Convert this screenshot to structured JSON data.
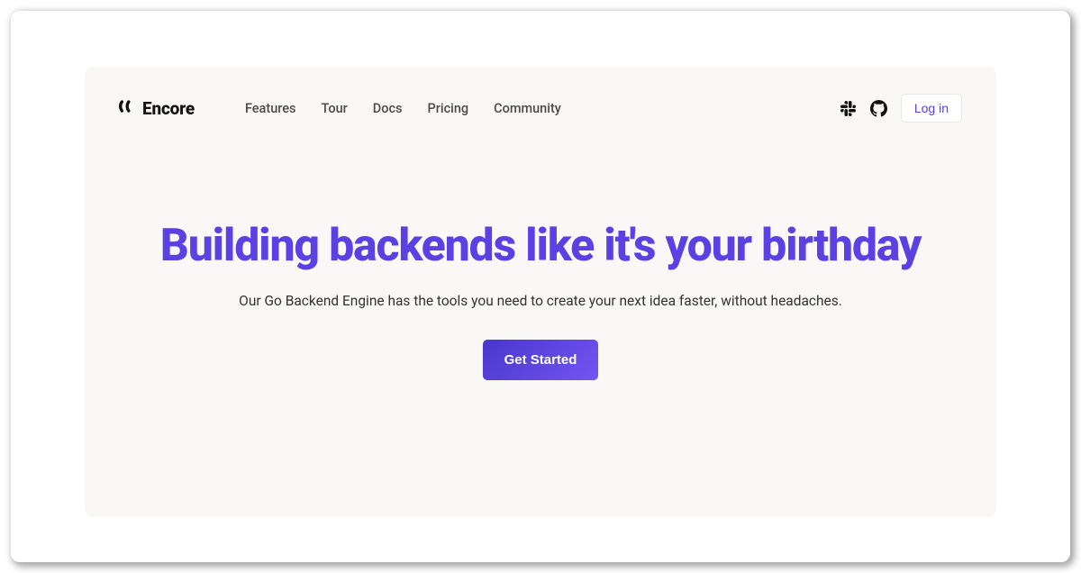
{
  "brand": {
    "name": "Encore"
  },
  "nav": {
    "items": [
      "Features",
      "Tour",
      "Docs",
      "Pricing",
      "Community"
    ],
    "login": "Log in"
  },
  "hero": {
    "title": "Building backends like it's your birthday",
    "subtitle": "Our Go Backend Engine has the tools you need to create your next idea faster, without headaches.",
    "cta": "Get Started"
  },
  "colors": {
    "accent": "#5B40E4",
    "background": "#F9F8F6"
  }
}
